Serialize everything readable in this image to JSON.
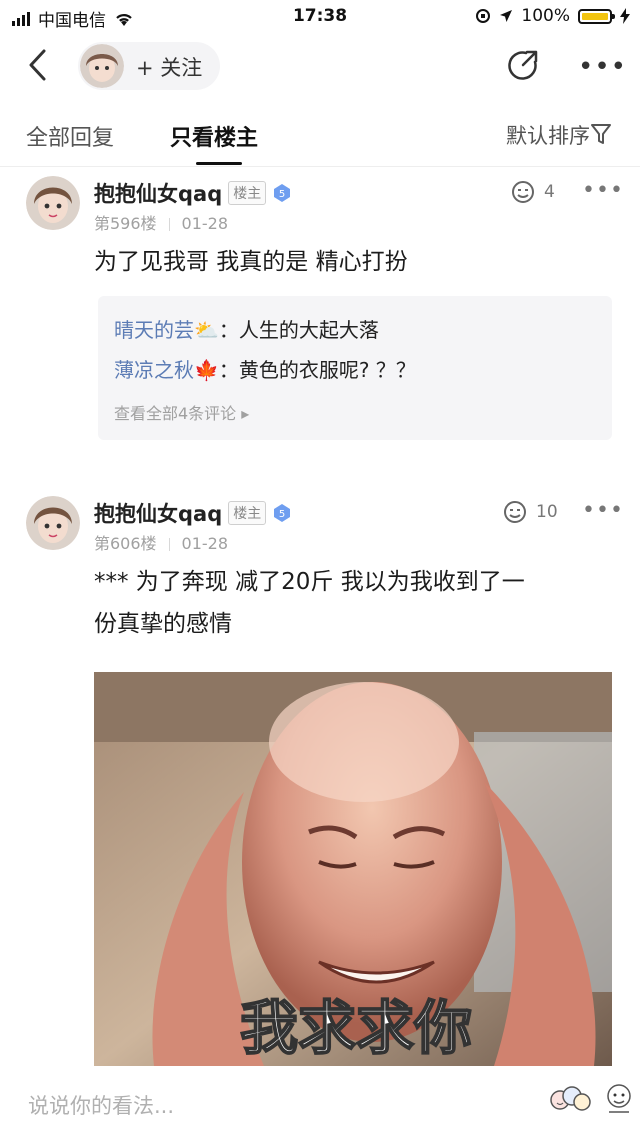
{
  "status_bar": {
    "carrier": "中国电信",
    "time": "17:38",
    "battery": "100%",
    "battery_level": 1.0
  },
  "nav": {
    "follow_label": "+ 关注",
    "icons": [
      "back-arrow-icon",
      "share-icon",
      "more-icon"
    ]
  },
  "tabs": {
    "all_replies": "全部回复",
    "op_only": "只看楼主",
    "sort_label": "默认排序"
  },
  "posts": [
    {
      "username": "抱抱仙女qaq",
      "badge": "楼主",
      "level": "5",
      "floor": "第596楼",
      "date": "01-28",
      "likes": "4",
      "content": "为了见我哥 我真的是 精心打扮",
      "comments": [
        {
          "name": "晴天的芸",
          "emoji": "⛅",
          "text": "：人生的大起大落"
        },
        {
          "name": "薄凉之秋",
          "emoji": "🍁",
          "text": "：黄色的衣服呢? ？？"
        }
      ],
      "more_comments": "查看全部4条评论 ▸"
    },
    {
      "username": "抱抱仙女qaq",
      "badge": "楼主",
      "level": "5",
      "floor": "第606楼",
      "date": "01-28",
      "likes": "10",
      "content_line1": "*** 为了奔现 减了20斤 我以为我收到了一",
      "content_line2": "份真挚的感情",
      "image_caption": "我求求你"
    }
  ],
  "bottom": {
    "placeholder": "说说你的看法..."
  }
}
